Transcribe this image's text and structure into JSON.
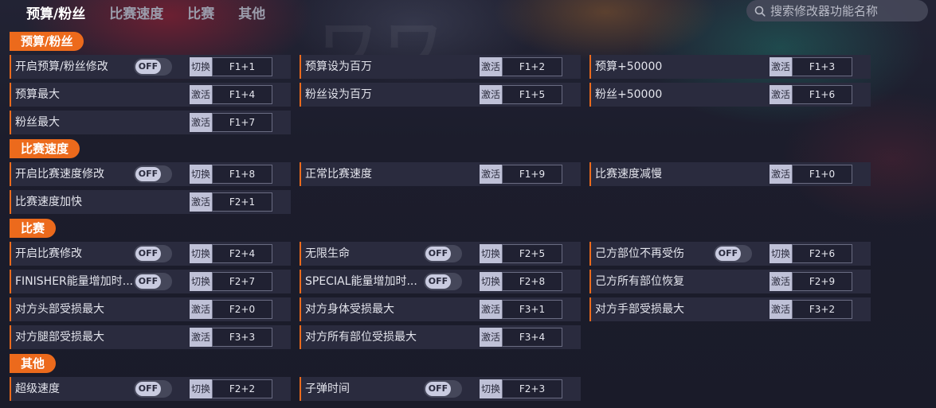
{
  "nav": {
    "tabs": [
      {
        "label": "预算/粉丝",
        "active": true
      },
      {
        "label": "比赛速度",
        "active": false
      },
      {
        "label": "比赛",
        "active": false
      },
      {
        "label": "其他",
        "active": false
      }
    ]
  },
  "search": {
    "placeholder": "搜索修改器功能名称"
  },
  "colors": {
    "accent": "#ec6a1c",
    "background": "#1b1c2b",
    "cell": "#2a2b3e",
    "toggle_knob": "#c9cbe0"
  },
  "sections": [
    {
      "title": "预算/粉丝",
      "rows": [
        [
          {
            "label": "开启预算/粉丝修改",
            "toggle": "OFF",
            "action": "切换",
            "key": "F1+1"
          },
          {
            "label": "预算设为百万",
            "action": "激活",
            "key": "F1+2"
          },
          {
            "label": "预算+50000",
            "action": "激活",
            "key": "F1+3"
          }
        ],
        [
          {
            "label": "预算最大",
            "action": "激活",
            "key": "F1+4"
          },
          {
            "label": "粉丝设为百万",
            "action": "激活",
            "key": "F1+5"
          },
          {
            "label": "粉丝+50000",
            "action": "激活",
            "key": "F1+6"
          }
        ],
        [
          {
            "label": "粉丝最大",
            "action": "激活",
            "key": "F1+7"
          }
        ]
      ]
    },
    {
      "title": "比赛速度",
      "rows": [
        [
          {
            "label": "开启比赛速度修改",
            "toggle": "OFF",
            "action": "切换",
            "key": "F1+8"
          },
          {
            "label": "正常比赛速度",
            "action": "激活",
            "key": "F1+9"
          },
          {
            "label": "比赛速度减慢",
            "action": "激活",
            "key": "F1+0"
          }
        ],
        [
          {
            "label": "比赛速度加快",
            "action": "激活",
            "key": "F2+1"
          }
        ]
      ]
    },
    {
      "title": "比赛",
      "rows": [
        [
          {
            "label": "开启比赛修改",
            "toggle": "OFF",
            "action": "切换",
            "key": "F2+4"
          },
          {
            "label": "无限生命",
            "toggle": "OFF",
            "action": "切换",
            "key": "F2+5"
          },
          {
            "label": "己方部位不再受伤",
            "toggle": "OFF",
            "action": "切换",
            "key": "F2+6"
          }
        ],
        [
          {
            "label": "FINISHER能量增加时...",
            "toggle": "OFF",
            "action": "切换",
            "key": "F2+7"
          },
          {
            "label": "SPECIAL能量增加时...",
            "toggle": "OFF",
            "action": "切换",
            "key": "F2+8"
          },
          {
            "label": "己方所有部位恢复",
            "action": "激活",
            "key": "F2+9"
          }
        ],
        [
          {
            "label": "对方头部受损最大",
            "action": "激活",
            "key": "F2+0"
          },
          {
            "label": "对方身体受损最大",
            "action": "激活",
            "key": "F3+1"
          },
          {
            "label": "对方手部受损最大",
            "action": "激活",
            "key": "F3+2"
          }
        ],
        [
          {
            "label": "对方腿部受损最大",
            "action": "激活",
            "key": "F3+3"
          },
          {
            "label": "对方所有部位受损最大",
            "action": "激活",
            "key": "F3+4"
          }
        ]
      ]
    },
    {
      "title": "其他",
      "rows": [
        [
          {
            "label": "超级速度",
            "toggle": "OFF",
            "action": "切换",
            "key": "F2+2"
          },
          {
            "label": "子弹时间",
            "toggle": "OFF",
            "action": "切换",
            "key": "F2+3"
          }
        ]
      ]
    }
  ]
}
